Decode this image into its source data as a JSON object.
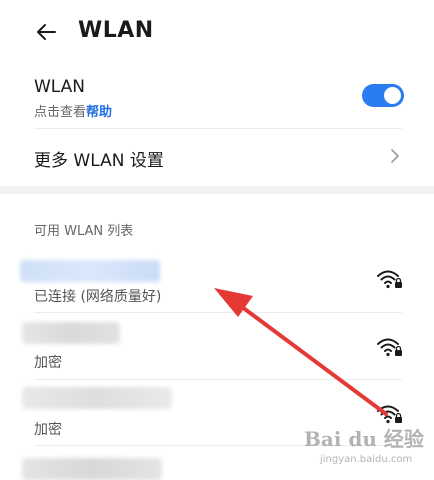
{
  "header": {
    "title": "WLAN",
    "back_icon": "arrow-left-icon"
  },
  "wlan_toggle": {
    "label": "WLAN",
    "help_prefix": "点击查看",
    "help_link": "帮助",
    "enabled": true,
    "accent_color": "#2b7cf0"
  },
  "more_settings": {
    "label": "更多 WLAN 设置",
    "icon": "chevron-right-icon"
  },
  "networks_section": {
    "title": "可用 WLAN 列表",
    "items": [
      {
        "status": "已连接 (网络质量好)",
        "secured": true,
        "connected": true
      },
      {
        "status": "加密",
        "secured": true,
        "connected": false
      },
      {
        "status": "加密",
        "secured": true,
        "connected": false
      },
      {
        "status": "",
        "secured": true,
        "connected": false
      }
    ]
  },
  "annotation": {
    "type": "red-arrow",
    "color": "#e53935"
  },
  "watermark": {
    "brand": "Bai du 经验",
    "url": "jingyan.baidu.com"
  }
}
